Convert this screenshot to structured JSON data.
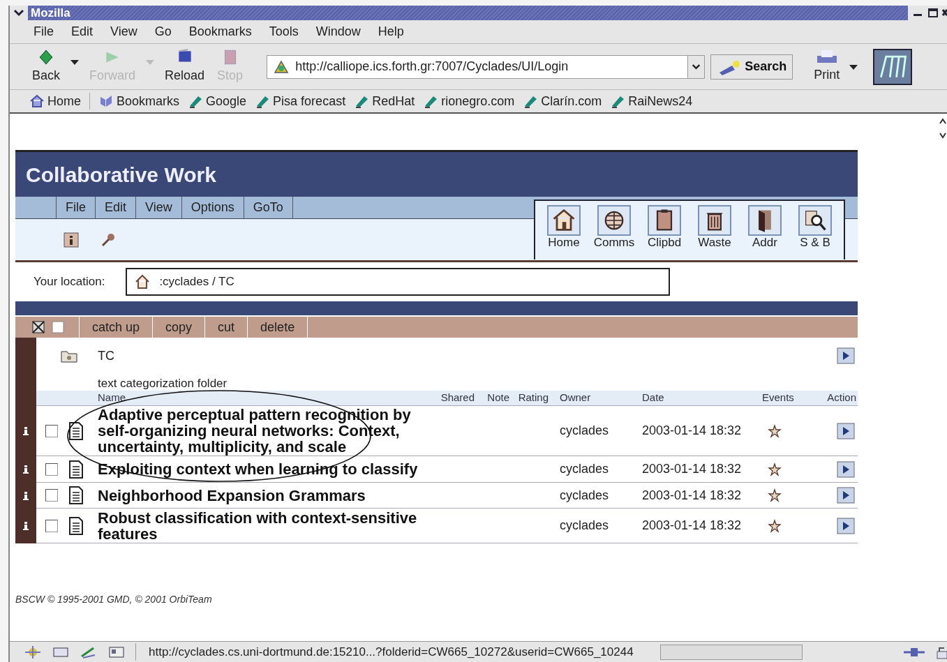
{
  "window": {
    "title": "Mozilla"
  },
  "menu": [
    "File",
    "Edit",
    "View",
    "Go",
    "Bookmarks",
    "Tools",
    "Window",
    "Help"
  ],
  "nav_buttons": [
    {
      "label": "Back",
      "disabled": false,
      "kind": "back"
    },
    {
      "label": "Forward",
      "disabled": true,
      "kind": "forward"
    },
    {
      "label": "Reload",
      "disabled": false,
      "kind": "reload"
    },
    {
      "label": "Stop",
      "disabled": true,
      "kind": "stop"
    }
  ],
  "url": "http://calliope.ics.forth.gr:7007/Cyclades/UI/Login",
  "search_button": "Search",
  "print_button": "Print",
  "bookmarks": [
    {
      "label": "Home",
      "kind": "home"
    },
    {
      "label": "Bookmarks",
      "kind": "folder"
    },
    {
      "label": "Google",
      "kind": "link"
    },
    {
      "label": "Pisa forecast",
      "kind": "link"
    },
    {
      "label": "RedHat",
      "kind": "link"
    },
    {
      "label": "rionegro.com",
      "kind": "link"
    },
    {
      "label": "Clarín.com",
      "kind": "link"
    },
    {
      "label": "RaiNews24",
      "kind": "link"
    }
  ],
  "page": {
    "title": "Collaborative Work",
    "menu": [
      "File",
      "Edit",
      "View",
      "Options",
      "GoTo"
    ],
    "nav_icons": [
      {
        "label": "Home",
        "kind": "home"
      },
      {
        "label": "Comms",
        "kind": "globe"
      },
      {
        "label": "Clipbd",
        "kind": "clipboard"
      },
      {
        "label": "Waste",
        "kind": "trash"
      },
      {
        "label": "Addr",
        "kind": "book"
      },
      {
        "label": "S & B",
        "kind": "search"
      }
    ],
    "location_label": "Your location:",
    "location_path": ":cyclades / TC",
    "actions": [
      "catch up",
      "copy",
      "cut",
      "delete"
    ],
    "folder": {
      "name": "TC",
      "description": "text categorization folder"
    },
    "columns": [
      "Name",
      "Shared",
      "Note",
      "Rating",
      "Owner",
      "Date",
      "Events",
      "Action"
    ],
    "rows": [
      {
        "title": "Adaptive perceptual pattern recognition by self-organizing neural networks: Context, uncertainty, multiplicity, and scale",
        "owner": "cyclades",
        "date": "2003-01-14 18:32",
        "checked": false
      },
      {
        "title": "Exploiting context when learning to classify",
        "owner": "cyclades",
        "date": "2003-01-14 18:32",
        "checked": false
      },
      {
        "title": "Neighborhood Expansion Grammars",
        "owner": "cyclades",
        "date": "2003-01-14 18:32",
        "checked": false
      },
      {
        "title": "Robust classification with context-sensitive features",
        "owner": "cyclades",
        "date": "2003-01-14 18:32",
        "checked": false
      }
    ],
    "footer": "BSCW © 1995-2001 GMD, © 2001 OrbiTeam"
  },
  "status_bar": {
    "text": "http://cyclades.cs.uni-dortmund.de:15210...?folderid=CW665_10272&userid=CW665_10244"
  }
}
